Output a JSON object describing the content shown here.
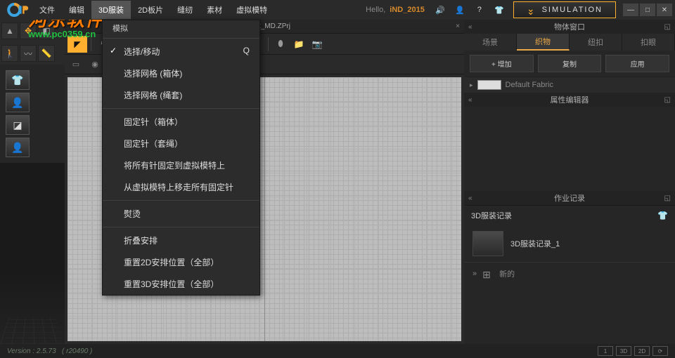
{
  "menubar": {
    "items": [
      "文件",
      "编辑",
      "3D服装",
      "2D板片",
      "缝纫",
      "素材",
      "虚拟模特"
    ],
    "active_index": 2,
    "submenu_label": "模拟",
    "hello": "Hello,",
    "user": "iND_2015",
    "simulation_label": "SIMULATION"
  },
  "watermark": {
    "name": "河东软件园",
    "url": "www.pc0359.cn"
  },
  "dropdown": {
    "items": [
      {
        "label": "选择/移动",
        "shortcut": "Q",
        "selected": true
      },
      {
        "label": "选择网格 (箱体)"
      },
      {
        "label": "选择网格 (绳套)"
      },
      {
        "sep": true
      },
      {
        "label": "固定针（箱体）"
      },
      {
        "label": "固定针（套绳）"
      },
      {
        "label": "将所有针固定到虚拟模特上"
      },
      {
        "label": "从虚拟模特上移走所有固定针"
      },
      {
        "sep": true
      },
      {
        "label": "熨烫"
      },
      {
        "sep": true
      },
      {
        "label": "折叠安排"
      },
      {
        "label": "重置2D安排位置（全部）"
      },
      {
        "label": "重置3D安排位置（全部）"
      }
    ]
  },
  "tab": {
    "filename": "Default_MD.ZPrj"
  },
  "right": {
    "panel1_title": "物体窗口",
    "tabs": [
      "场景",
      "织物",
      "纽扣",
      "扣眼"
    ],
    "active_tab": 1,
    "actions": {
      "add": "+ 增加",
      "copy": "复制",
      "apply": "应用"
    },
    "fabric_name": "Default Fabric",
    "panel2_title": "属性编辑器",
    "panel3_title": "作业记录",
    "jobs_title": "3D服装记录",
    "job_item": "3D服装记录_1",
    "new_label": "新的"
  },
  "status": {
    "version_label": "Version :",
    "version": "2.5.73",
    "build": "( r20490 )",
    "views": [
      "1",
      "3D",
      "2D",
      "⟳"
    ]
  }
}
